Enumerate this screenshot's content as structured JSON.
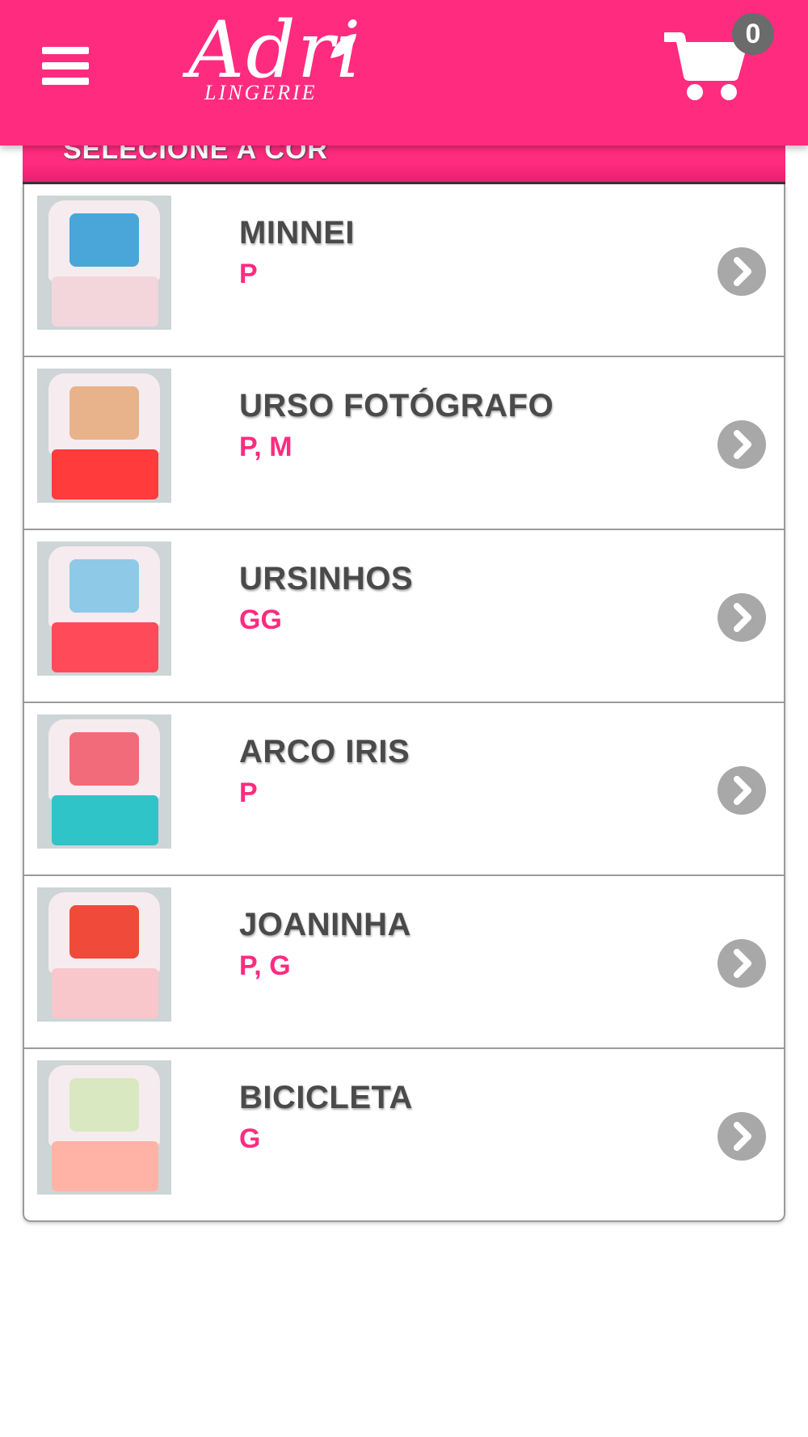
{
  "header": {
    "logo_script": "Adri",
    "logo_sub": "LINGERIE",
    "cart_count": "0",
    "brand_color": "#ff2b7f",
    "menu_icon": "hamburger-menu-icon",
    "cart_icon": "shopping-cart-icon"
  },
  "section": {
    "title": "SELECIONE A COR"
  },
  "products": [
    {
      "name": "MINNEI",
      "sizes": "P",
      "thumb_icon": "pajama-image",
      "print_color": "#4aa6d8",
      "pants_color": "#f3d6dc"
    },
    {
      "name": "URSO FOTÓGRAFO",
      "sizes": "P, M",
      "thumb_icon": "pajama-image",
      "print_color": "#e8b28a",
      "pants_color": "#ff3b3b"
    },
    {
      "name": "URSINHOS",
      "sizes": "GG",
      "thumb_icon": "pajama-image",
      "print_color": "#8fc9e8",
      "pants_color": "#ff4a5a"
    },
    {
      "name": "ARCO IRIS",
      "sizes": "P",
      "thumb_icon": "pajama-image",
      "print_color": "#f26b7a",
      "pants_color": "#2ec4c8"
    },
    {
      "name": "JOANINHA",
      "sizes": "P, G",
      "thumb_icon": "pajama-image",
      "print_color": "#f04a3a",
      "pants_color": "#f7c7cc"
    },
    {
      "name": "BICICLETA",
      "sizes": "G",
      "thumb_icon": "pajama-image",
      "print_color": "#d9e8c0",
      "pants_color": "#ffb3a6"
    }
  ]
}
